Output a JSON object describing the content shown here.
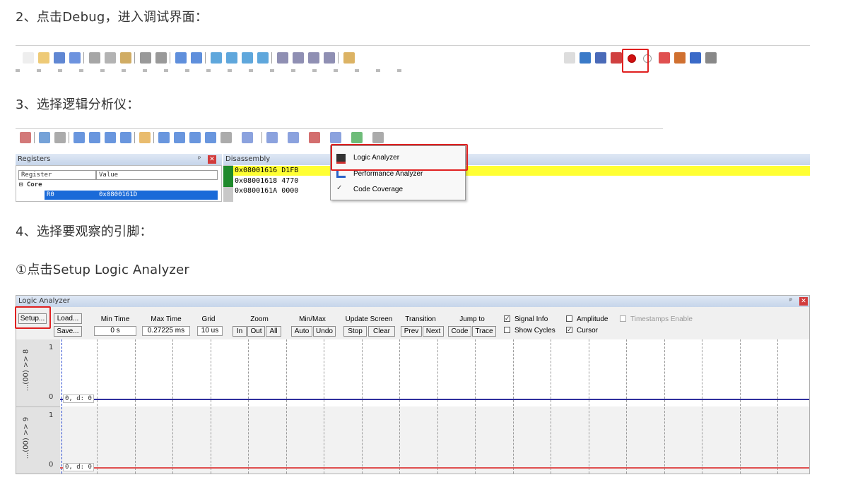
{
  "steps": {
    "step2": "2、点击Debug，进入调试界面：",
    "step3": "3、选择逻辑分析仪：",
    "step4": "4、选择要观察的引脚：",
    "step4a": "①点击Setup Logic Analyzer"
  },
  "toolbar1": {
    "icons": [
      "new-file-icon",
      "open-folder-icon",
      "save-icon",
      "save-all-icon",
      "cut-icon",
      "copy-icon",
      "paste-icon",
      "undo-icon",
      "redo-icon",
      "nav-back-icon",
      "nav-forward-icon",
      "bookmark-icon",
      "bookmark-prev-icon",
      "bookmark-next-icon",
      "bookmark-clear-icon",
      "indent-icon",
      "unindent-icon",
      "comment-icon",
      "uncomment-icon",
      "find-in-files-icon"
    ],
    "right_icons": [
      "target-select-icon",
      "translate-icon",
      "build-icon",
      "debug-icon",
      "breakpoint-icon",
      "breakpoint-disable-icon",
      "breakpoint-kill-icon",
      "breakpoint-kill-all-icon",
      "window-layout-icon",
      "options-icon"
    ]
  },
  "toolbar2": {
    "icons": [
      "reset-icon",
      "run-icon",
      "stop-icon",
      "step-into-icon",
      "step-over-icon",
      "step-out-icon",
      "run-to-cursor-icon",
      "show-next-statement-icon",
      "command-window-icon",
      "disassembly-window-icon",
      "symbols-window-icon",
      "registers-window-icon",
      "call-stack-icon",
      "watch-window-icon",
      "memory-window-icon",
      "serial-window-icon",
      "analysis-window-icon",
      "trace-window-icon",
      "system-viewer-icon",
      "toolbox-icon"
    ]
  },
  "registers_pane": {
    "title": "Registers",
    "pin": "ᵖ",
    "col_register": "Register",
    "col_value": "Value",
    "group": "Core",
    "row_name": "R0",
    "row_value": "0x0800161D"
  },
  "disassembly_pane": {
    "title": "Disassembly",
    "lines": [
      "0x08001616 D1FB",
      "0x08001618 4770",
      "0x0800161A 0000"
    ]
  },
  "analysis_menu": {
    "items": [
      "Logic Analyzer",
      "Performance Analyzer",
      "Code Coverage"
    ]
  },
  "logic_analyzer": {
    "title": "Logic Analyzer",
    "setup": "Setup...",
    "load": "Load...",
    "save": "Save...",
    "min_time_label": "Min Time",
    "min_time_value": "0 s",
    "max_time_label": "Max Time",
    "max_time_value": "0.27225 ms",
    "grid_label": "Grid",
    "grid_value": "10 us",
    "zoom_label": "Zoom",
    "zoom_in": "In",
    "zoom_out": "Out",
    "zoom_all": "All",
    "minmax_label": "Min/Max",
    "minmax_auto": "Auto",
    "minmax_undo": "Undo",
    "update_label": "Update Screen",
    "update_stop": "Stop",
    "update_clear": "Clear",
    "transition_label": "Transition",
    "transition_prev": "Prev",
    "transition_next": "Next",
    "jump_label": "Jump to",
    "jump_code": "Code",
    "jump_trace": "Trace",
    "signal_info": "Signal Info",
    "amplitude": "Amplitude",
    "timestamps": "Timestamps Enable",
    "show_cycles": "Show Cycles",
    "cursor": "Cursor",
    "signal1_name": "...(00) >> 8",
    "signal2_name": "...(00) >> 9",
    "high": "1",
    "low": "0",
    "readout": "0,   d: 0"
  }
}
